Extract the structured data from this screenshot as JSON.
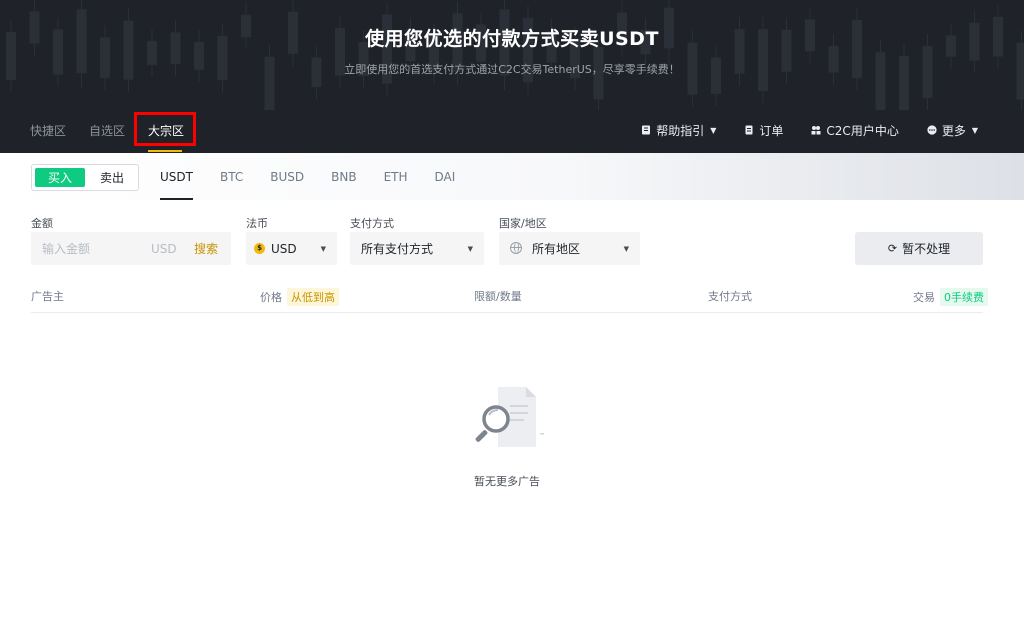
{
  "hero": {
    "title": "使用您优选的付款方式买卖USDT",
    "subtitle": "立即使用您的首选支付方式通过C2C交易TetherUS，尽享零手续费！"
  },
  "nav": {
    "tabs": [
      "快捷区",
      "自选区",
      "大宗区"
    ],
    "active_tab": "大宗区",
    "right": [
      {
        "label": "帮助指引",
        "icon": "help-guide-icon",
        "dropdown": true
      },
      {
        "label": "订单",
        "icon": "order-icon",
        "dropdown": false
      },
      {
        "label": "C2C用户中心",
        "icon": "user-center-icon",
        "dropdown": false
      },
      {
        "label": "更多",
        "icon": "more-icon",
        "dropdown": true
      }
    ]
  },
  "trade": {
    "buy_label": "买入",
    "sell_label": "卖出",
    "assets": [
      "USDT",
      "BTC",
      "BUSD",
      "BNB",
      "ETH",
      "DAI"
    ],
    "active_asset": "USDT"
  },
  "filters": {
    "amount_label": "金额",
    "amount_placeholder": "输入金额",
    "amount_unit": "USD",
    "search_label": "搜索",
    "fiat_label": "法币",
    "fiat_value": "USD",
    "fiat_symbol": "$",
    "payment_label": "支付方式",
    "payment_value": "所有支付方式",
    "region_label": "国家/地区",
    "region_value": "所有地区",
    "refresh_label": "暂不处理"
  },
  "table": {
    "advertiser": "广告主",
    "price": "价格",
    "price_sort": "从低到高",
    "limit": "限额/数量",
    "payment": "支付方式",
    "trade": "交易",
    "fee_badge": "0手续费"
  },
  "empty": {
    "message": "暂无更多广告"
  },
  "colors": {
    "hero_bg": "#1f2229",
    "buy_green": "#0ecb81",
    "accent_yellow": "#f0b90b",
    "highlight_red": "#ff0000"
  }
}
